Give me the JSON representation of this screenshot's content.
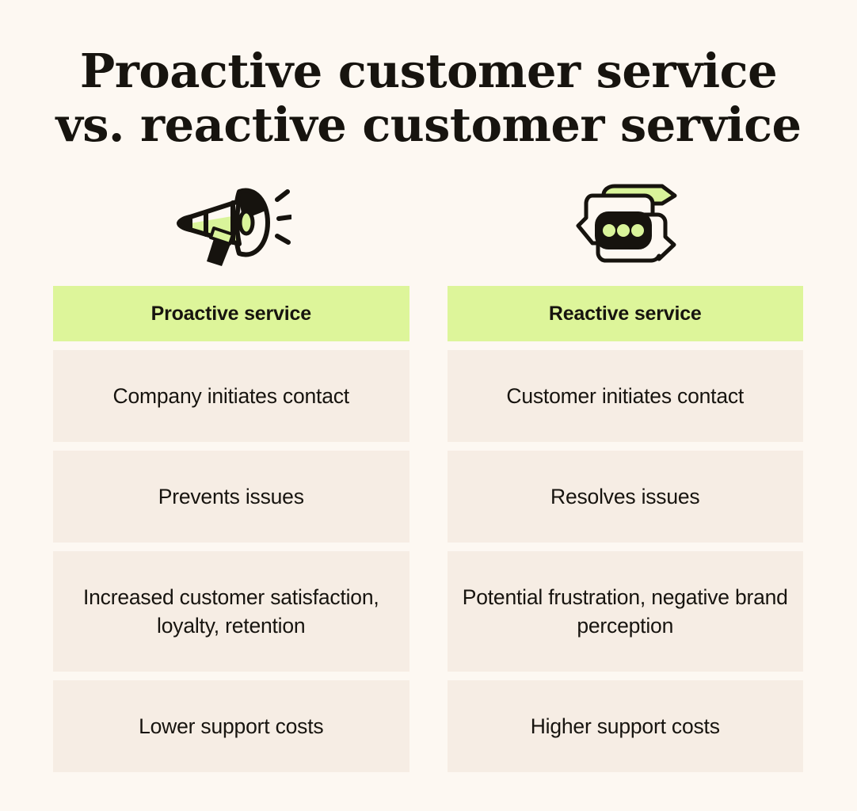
{
  "title": {
    "line1": "Proactive customer service",
    "line2": "vs. reactive customer service"
  },
  "colors": {
    "background": "#FDF8F2",
    "header_green": "#DDF59A",
    "cell_beige": "#F6EDE4",
    "text_dark": "#17140F",
    "accent_black": "#16130E"
  },
  "icons": {
    "left": "megaphone-icon",
    "right": "chat-bubbles-icon"
  },
  "table": {
    "headers": [
      "Proactive service",
      "Reactive service"
    ],
    "rows": [
      {
        "left": "Company initiates contact",
        "right": "Customer initiates contact",
        "tall": false
      },
      {
        "left": "Prevents issues",
        "right": "Resolves issues",
        "tall": false
      },
      {
        "left": "Increased customer satisfaction, loyalty, retention",
        "right": "Potential frustration, negative brand perception",
        "tall": true
      },
      {
        "left": "Lower support costs",
        "right": "Higher support costs",
        "tall": false
      }
    ]
  }
}
